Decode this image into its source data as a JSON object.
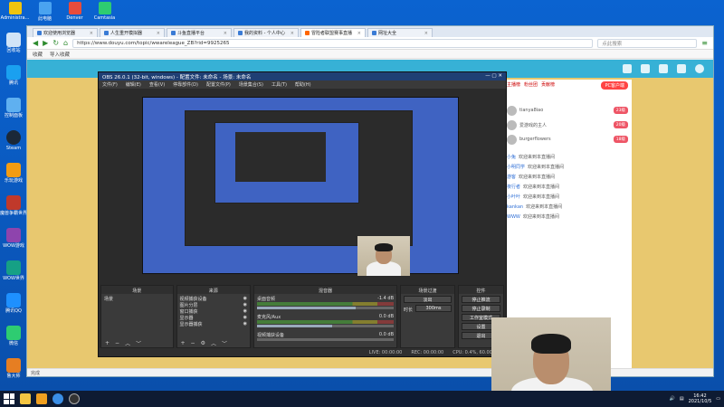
{
  "desktop": {
    "top_icons": [
      {
        "label": "Administra...",
        "icon": "user-folder-icon",
        "color": "#f1c40f"
      },
      {
        "label": "此电脑",
        "icon": "computer-icon",
        "color": "#4aa3f0"
      },
      {
        "label": "Denver",
        "icon": "denver-icon",
        "color": "#e74c3c"
      },
      {
        "label": "Camtasia",
        "icon": "camtasia-icon",
        "color": "#2ecc71"
      }
    ],
    "left_icons": [
      {
        "label": "回收站",
        "icon": "recycle-bin-icon",
        "color": "#d0e4f7"
      },
      {
        "label": "腾讯",
        "icon": "tencent-icon",
        "color": "#1aa0f0"
      },
      {
        "label": "控制面板",
        "icon": "control-panel-icon",
        "color": "#5fb0f0"
      },
      {
        "label": "Steam",
        "icon": "steam-icon",
        "color": "#1b2838"
      },
      {
        "label": "乐玩游戏",
        "icon": "game-icon",
        "color": "#f39c12"
      },
      {
        "label": "魔兽争霸世界",
        "icon": "wow-icon",
        "color": "#c0392b"
      },
      {
        "label": "WOW游戏",
        "icon": "wow2-icon",
        "color": "#8e44ad"
      },
      {
        "label": "WOW世界",
        "icon": "wow3-icon",
        "color": "#16a085"
      },
      {
        "label": "腾讯QQ",
        "icon": "qq-icon",
        "color": "#1e90ff"
      },
      {
        "label": "微信",
        "icon": "wechat-icon",
        "color": "#2ecc71"
      },
      {
        "label": "鲁大师",
        "icon": "ludashi-icon",
        "color": "#e67e22"
      }
    ]
  },
  "browser": {
    "tabs": [
      {
        "label": "欢迎使用浏览器",
        "active": false
      },
      {
        "label": "人生重开模拟器",
        "active": false
      },
      {
        "label": "斗鱼直播平台",
        "active": false
      },
      {
        "label": "我的资料 - 个人中心",
        "active": false
      },
      {
        "label": "冒险者联盟赛事直播",
        "active": true
      },
      {
        "label": "网址大全",
        "active": false
      }
    ],
    "url": "https://www.douyu.com/topic/wwareleague_ZB?rid=9925265",
    "search_placeholder": "点此搜索",
    "bookmarks": [
      "收藏",
      "导入收藏"
    ],
    "status": "完成"
  },
  "douyu": {
    "pc_button": "PC客户端",
    "right_tabs": [
      "主播榜",
      "粉丝团",
      "贡献榜"
    ],
    "rank": [
      {
        "name": "tianya8iao",
        "badge": "23级"
      },
      {
        "name": "爱游戏的主人",
        "badge": "20级"
      },
      {
        "name": "burgerflowers",
        "badge": "18级"
      }
    ],
    "messages": [
      {
        "user": "小兔",
        "text": "欢迎来到本直播间"
      },
      {
        "user": "小明同学",
        "text": "欢迎来到本直播间"
      },
      {
        "user": "游客",
        "text": "欢迎来到本直播间"
      },
      {
        "user": "夜行者",
        "text": "欢迎来到本直播间"
      },
      {
        "user": "小叶叶",
        "text": "欢迎来到本直播间"
      },
      {
        "user": "kankan",
        "text": "欢迎来到本直播间"
      },
      {
        "user": "WWW",
        "text": "欢迎来到本直播间"
      }
    ]
  },
  "obs": {
    "title": "OBS 26.0.1 (32-bit, windows) - 配置文件: 未命名 - 场景: 未命名",
    "menu": [
      "文件(F)",
      "编辑(E)",
      "查看(V)",
      "停靠部件(D)",
      "配置文件(P)",
      "场景集合(S)",
      "工具(T)",
      "帮助(H)"
    ],
    "docks": {
      "scenes_title": "场景",
      "scenes": [
        "场景"
      ],
      "sources_title": "来源",
      "sources": [
        "视频捕获设备",
        "图片分层",
        "窗口捕获",
        "显示器",
        "显示器捕获"
      ],
      "mixer_title": "混音器",
      "mixer": [
        {
          "name": "桌面音频",
          "db": "-1.4 dB",
          "level": 0.72
        },
        {
          "name": "麦克风/Aux",
          "db": "0.0 dB",
          "level": 0.55
        },
        {
          "name": "视频捕获设备",
          "db": "0.0 dB",
          "level": 0.0
        }
      ],
      "transition_title": "场景过渡",
      "transition_value": "淡出",
      "duration_label": "时长",
      "duration_value": "300ms",
      "controls_title": "控件",
      "controls": [
        "停止推流",
        "停止录制",
        "工作室模式",
        "设置",
        "退出"
      ]
    },
    "status": {
      "live": "LIVE: 00:00:00",
      "rec": "REC: 00:00:00",
      "cpu": "CPU: 0.4%, 60.00 fps"
    }
  },
  "taskbar": {
    "time": "16:42",
    "date": "2021/10/5"
  }
}
